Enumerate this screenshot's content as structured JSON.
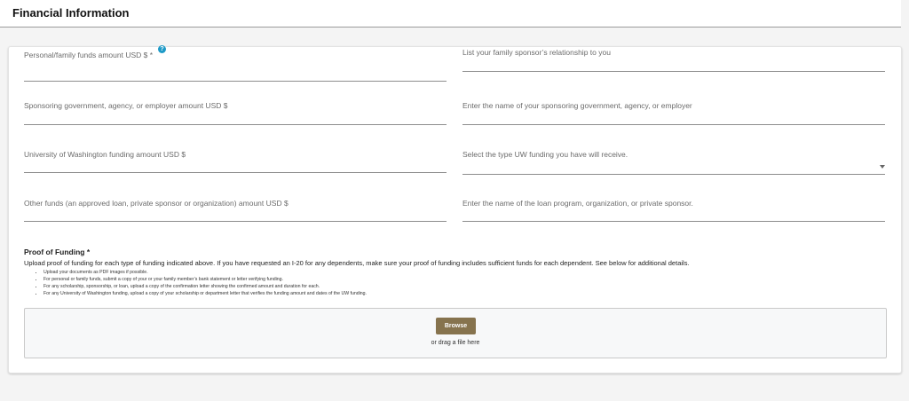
{
  "header": {
    "title": "Financial Information"
  },
  "fields": {
    "personal_funds": {
      "label": "Personal/family funds amount USD $ *",
      "help_icon": "?"
    },
    "sponsor_relationship": {
      "label": "List your family sponsor’s relationship to you"
    },
    "gov_funds": {
      "label": "Sponsoring government, agency, or employer amount USD $"
    },
    "gov_name": {
      "label": "Enter the name of your sponsoring government, agency, or employer"
    },
    "uw_funds": {
      "label": "University of Washington funding amount USD $"
    },
    "uw_type": {
      "label": "Select the type UW funding you have will receive."
    },
    "other_funds": {
      "label": "Other funds (an approved loan, private sponsor or organization) amount USD $"
    },
    "other_name": {
      "label": "Enter the name of the loan program, organization, or private sponsor."
    }
  },
  "proof": {
    "title": "Proof of Funding *",
    "description": "Upload proof of funding for each type of funding indicated above. If you have requested an I-20 for any dependents, make sure your proof of funding includes sufficient funds for each dependent. See below for additional details.",
    "bullets": [
      "Upload your documents as PDF images if possible.",
      "For personal or family funds, submit a copy of your or your family member’s bank statement or letter verifying funding.",
      "For any scholarship, sponsorship, or loan, upload a copy of the confirmation letter showing the confirmed amount and duration for each.",
      "For any University of Washington funding, upload a copy of your scholarship or department letter that verifies the funding amount and dates of the UW funding."
    ]
  },
  "upload": {
    "browse_label": "Browse",
    "drag_text": "or drag a file here"
  },
  "colors": {
    "accent": "#86734e",
    "help": "#1e9ac7"
  }
}
